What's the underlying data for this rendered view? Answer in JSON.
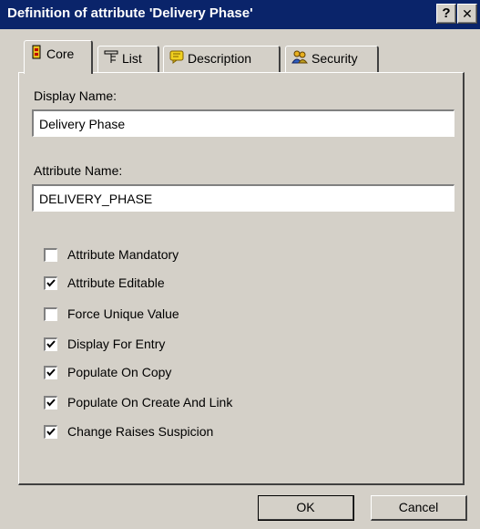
{
  "window": {
    "title": "Definition of attribute 'Delivery Phase'",
    "help_label": "?",
    "close_label": "✕"
  },
  "tabs": [
    {
      "label": "Core",
      "icon": "core-icon",
      "active": true
    },
    {
      "label": "List",
      "icon": "list-icon",
      "active": false
    },
    {
      "label": "Description",
      "icon": "description-icon",
      "active": false
    },
    {
      "label": "Security",
      "icon": "security-icon",
      "active": false
    }
  ],
  "form": {
    "display_name_label": "Display Name:",
    "display_name_value": "Delivery Phase",
    "attribute_name_label": "Attribute Name:",
    "attribute_name_value": "DELIVERY_PHASE"
  },
  "options": [
    {
      "label": "Attribute Mandatory",
      "checked": false
    },
    {
      "label": "Attribute Editable",
      "checked": true
    },
    {
      "label": "Force Unique Value",
      "checked": false
    },
    {
      "label": "Display For Entry",
      "checked": true
    },
    {
      "label": "Populate On Copy",
      "checked": true
    },
    {
      "label": "Populate On Create And Link",
      "checked": true
    },
    {
      "label": "Change Raises Suspicion",
      "checked": true
    }
  ],
  "buttons": {
    "ok_label": "OK",
    "cancel_label": "Cancel"
  },
  "colors": {
    "titlebar": "#0a246a",
    "face": "#d4d0c8"
  }
}
